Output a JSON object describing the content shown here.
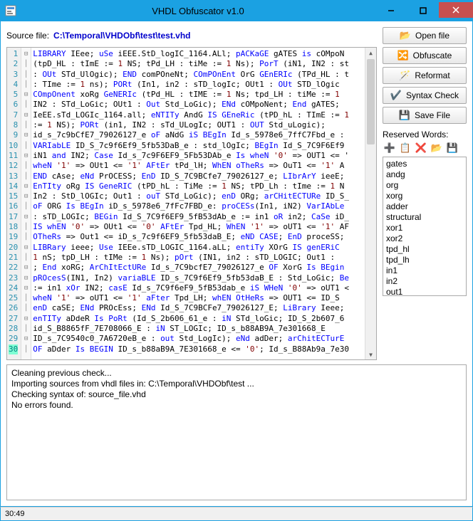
{
  "title": "VHDL Obfuscator v1.0",
  "source_label": "Source file:",
  "source_path": "C:\\Temporal\\VHDObf\\test\\test.vhd",
  "buttons": {
    "open": "Open file",
    "obfuscate": "Obfuscate",
    "reformat": "Reformat",
    "syntax": "Syntax Check",
    "save": "Save File"
  },
  "reserved_label": "Reserved Words:",
  "reserved_words": [
    "gates",
    "andg",
    "org",
    "xorg",
    "adder",
    "structural",
    "xor1",
    "xor2",
    "tpd_hl",
    "tpd_lh",
    "in1",
    "in2",
    "out1"
  ],
  "output_lines": [
    "Cleaning previous check...",
    "Importing sources from vhdl files in: C:\\Temporal\\VHDObf\\test ...",
    "Checking syntax of: source_file.vhd",
    "No errors found."
  ],
  "status": "30:49",
  "code_lines": [
    {
      "n": 1,
      "f": "⊟",
      "seg": [
        [
          "kw",
          "LIBRARY"
        ],
        [
          "txt",
          " IEee; "
        ],
        [
          "kw",
          "uSe"
        ],
        [
          "txt",
          " iEEE.StD_logIC_1164.ALl; "
        ],
        [
          "kw",
          "pACKaGE"
        ],
        [
          "txt",
          " gATES "
        ],
        [
          "kw",
          "is"
        ],
        [
          "txt",
          " cOMpoN"
        ]
      ]
    },
    {
      "n": 2,
      "f": "│",
      "seg": [
        [
          "txt",
          "(tpD_HL : tImE := "
        ],
        [
          "str",
          "1"
        ],
        [
          "txt",
          " NS; tPd_LH : tiMe := "
        ],
        [
          "str",
          "1"
        ],
        [
          "txt",
          " Ns); "
        ],
        [
          "kw",
          "PorT"
        ],
        [
          "txt",
          " (iN1, IN2 : st"
        ]
      ]
    },
    {
      "n": 3,
      "f": "│",
      "seg": [
        [
          "txt",
          ": "
        ],
        [
          "kw",
          "OUt"
        ],
        [
          "txt",
          " STd_UlOgic); "
        ],
        [
          "kw",
          "END"
        ],
        [
          "txt",
          " comPOneNt; "
        ],
        [
          "kw",
          "COmPOnEnt"
        ],
        [
          "txt",
          " OrG "
        ],
        [
          "kw",
          "GEnERIc"
        ],
        [
          "txt",
          " (TPd_HL : t"
        ]
      ]
    },
    {
      "n": 4,
      "f": "│",
      "seg": [
        [
          "txt",
          ": TIme := "
        ],
        [
          "str",
          "1"
        ],
        [
          "txt",
          " ns); "
        ],
        [
          "kw",
          "PORt"
        ],
        [
          "txt",
          " (In1, in2 : sTD_logIc; OUt1 : "
        ],
        [
          "kw",
          "OUt"
        ],
        [
          "txt",
          " STD_lOgic"
        ]
      ]
    },
    {
      "n": 5,
      "f": "⊟",
      "seg": [
        [
          "kw",
          "COmpOnent"
        ],
        [
          "txt",
          " xoRg "
        ],
        [
          "kw",
          "GeNERIc"
        ],
        [
          "txt",
          " (tPd_HL : tIME := "
        ],
        [
          "str",
          "1"
        ],
        [
          "txt",
          " Ns; tpd_LH : tiMe := "
        ],
        [
          "str",
          "1"
        ]
      ]
    },
    {
      "n": 6,
      "f": "│",
      "seg": [
        [
          "txt",
          "IN2 : STd_LoGic; OUt1 : "
        ],
        [
          "kw",
          "Out"
        ],
        [
          "txt",
          " Std_LoGic); "
        ],
        [
          "kw",
          "ENd"
        ],
        [
          "txt",
          " cOMpoNent; "
        ],
        [
          "kw",
          "End"
        ],
        [
          "txt",
          " gATES;"
        ]
      ]
    },
    {
      "n": 7,
      "f": "⊟",
      "seg": [
        [
          "txt",
          "IeEE.sTd_LOGIc_1164.all; "
        ],
        [
          "kw",
          "eNTITy"
        ],
        [
          "txt",
          " AndG "
        ],
        [
          "kw",
          "IS GEneRic"
        ],
        [
          "txt",
          " (tPD_hL : TImE := "
        ],
        [
          "str",
          "1"
        ]
      ]
    },
    {
      "n": 8,
      "f": "│",
      "seg": [
        [
          "txt",
          ":= "
        ],
        [
          "str",
          "1"
        ],
        [
          "txt",
          " NS); "
        ],
        [
          "kw",
          "PORt"
        ],
        [
          "txt",
          " (in1, IN2 : sTd_ULogIc; OUT1 : "
        ],
        [
          "kw",
          "OUT"
        ],
        [
          "txt",
          " Std_uLogic);"
        ]
      ]
    },
    {
      "n": 9,
      "f": "⊟",
      "seg": [
        [
          "txt",
          "id_s_7c9bCfE7_79026127_e "
        ],
        [
          "kw",
          "oF"
        ],
        [
          "txt",
          " aNdG "
        ],
        [
          "kw",
          "iS BEgIn"
        ],
        [
          "txt",
          " Id_s_5978e6_7ffC7Fbd_e :"
        ]
      ]
    },
    {
      "n": 10,
      "f": "│",
      "seg": [
        [
          "kw",
          "VARIabLE"
        ],
        [
          "txt",
          " ID_S_7c9f6Ef9_5fb53DaB_e : std_lOgIc; "
        ],
        [
          "kw",
          "BEgIn"
        ],
        [
          "txt",
          " Id_S_7C9F6Ef9"
        ]
      ]
    },
    {
      "n": 11,
      "f": "⊟",
      "seg": [
        [
          "txt",
          "iN1 "
        ],
        [
          "kw",
          "and"
        ],
        [
          "txt",
          " IN2; "
        ],
        [
          "kw",
          "Case"
        ],
        [
          "txt",
          " Id_s_7c9F6EF9_5Fb53DAb_e "
        ],
        [
          "kw",
          "Is wheN"
        ],
        [
          "txt",
          " "
        ],
        [
          "str",
          "'0'"
        ],
        [
          "txt",
          " => OUT1 <= '"
        ]
      ]
    },
    {
      "n": 12,
      "f": "│",
      "seg": [
        [
          "kw",
          "wheN"
        ],
        [
          "txt",
          " "
        ],
        [
          "str",
          "'1'"
        ],
        [
          "txt",
          " => OUt1 <= "
        ],
        [
          "str",
          "'1'"
        ],
        [
          "txt",
          " "
        ],
        [
          "kw",
          "AFtEr"
        ],
        [
          "txt",
          " tPd_lH; "
        ],
        [
          "kw",
          "WhEN oTheRs"
        ],
        [
          "txt",
          " => OuT1 <= "
        ],
        [
          "str",
          "'1'"
        ],
        [
          "txt",
          " A"
        ]
      ]
    },
    {
      "n": 13,
      "f": "│",
      "seg": [
        [
          "kw",
          "END"
        ],
        [
          "txt",
          " cAse; "
        ],
        [
          "kw",
          "eNd"
        ],
        [
          "txt",
          " PrOCESS; "
        ],
        [
          "kw",
          "EnD"
        ],
        [
          "txt",
          " ID_S_7C9BCfe7_79026127_e; "
        ],
        [
          "kw",
          "LIbrArY"
        ],
        [
          "txt",
          " ieeE;"
        ]
      ]
    },
    {
      "n": 14,
      "f": "⊟",
      "seg": [
        [
          "kw",
          "EnTIty"
        ],
        [
          "txt",
          " oRg "
        ],
        [
          "kw",
          "IS GeneRIC"
        ],
        [
          "txt",
          " (tPD_hL : TiMe := "
        ],
        [
          "str",
          "1"
        ],
        [
          "txt",
          " NS; tPD_Lh : tIme := "
        ],
        [
          "str",
          "1"
        ],
        [
          "txt",
          " N"
        ]
      ]
    },
    {
      "n": 15,
      "f": "⊟",
      "seg": [
        [
          "txt",
          "In2 : StD_lOGIc; Out1 : "
        ],
        [
          "kw",
          "ouT"
        ],
        [
          "txt",
          " STd_LoGic); "
        ],
        [
          "kw",
          "enD"
        ],
        [
          "txt",
          " ORg; "
        ],
        [
          "kw",
          "arCHitECTURe"
        ],
        [
          "txt",
          " ID_S_"
        ]
      ]
    },
    {
      "n": 16,
      "f": "│",
      "seg": [
        [
          "kw",
          "oF"
        ],
        [
          "txt",
          " ORG "
        ],
        [
          "kw",
          "Is BEgIn"
        ],
        [
          "txt",
          " iD_s_5978e6_7fFc7FBD_e: "
        ],
        [
          "kw",
          "proCESs"
        ],
        [
          "txt",
          "(In1, iN2) "
        ],
        [
          "kw",
          "VarIAbLe"
        ]
      ]
    },
    {
      "n": 17,
      "f": "⊟",
      "seg": [
        [
          "txt",
          ": sTD_LOGIc; "
        ],
        [
          "kw",
          "BEGin"
        ],
        [
          "txt",
          " Id_S_7C9f6EF9_5fB53dAb_e := in1 "
        ],
        [
          "kw",
          "oR"
        ],
        [
          "txt",
          " in2; "
        ],
        [
          "kw",
          "CaSe"
        ],
        [
          "txt",
          " iD_"
        ]
      ]
    },
    {
      "n": 18,
      "f": "│",
      "seg": [
        [
          "kw",
          "IS whEN"
        ],
        [
          "txt",
          " "
        ],
        [
          "str",
          "'0'"
        ],
        [
          "txt",
          " => OUt1 <= "
        ],
        [
          "str",
          "'0'"
        ],
        [
          "txt",
          " "
        ],
        [
          "kw",
          "AFtEr"
        ],
        [
          "txt",
          " Tpd_HL; "
        ],
        [
          "kw",
          "WhEN"
        ],
        [
          "txt",
          " "
        ],
        [
          "str",
          "'1'"
        ],
        [
          "txt",
          " => oUT1 <= "
        ],
        [
          "str",
          "'1'"
        ],
        [
          "txt",
          " AF"
        ]
      ]
    },
    {
      "n": 19,
      "f": "│",
      "seg": [
        [
          "kw",
          "OTheRs"
        ],
        [
          "txt",
          " => Out1 <= iD_s_7c9f6EF9_5fb53daB_E; "
        ],
        [
          "kw",
          "eND CASE"
        ],
        [
          "txt",
          "; "
        ],
        [
          "kw",
          "EnD"
        ],
        [
          "txt",
          " proceSS;"
        ]
      ]
    },
    {
      "n": 20,
      "f": "⊟",
      "seg": [
        [
          "kw",
          "LIBRary"
        ],
        [
          "txt",
          " ieee; "
        ],
        [
          "kw",
          "Use"
        ],
        [
          "txt",
          " IEEe.sTD_LOGIC_1164.aLL; "
        ],
        [
          "kw",
          "entiTy"
        ],
        [
          "txt",
          " XOrG "
        ],
        [
          "kw",
          "IS genERiC"
        ]
      ]
    },
    {
      "n": 21,
      "f": "│",
      "seg": [
        [
          "str",
          "1"
        ],
        [
          "txt",
          " nS; tpD_LH : tIMe := "
        ],
        [
          "str",
          "1"
        ],
        [
          "txt",
          " Ns); "
        ],
        [
          "kw",
          "pOrt"
        ],
        [
          "txt",
          " (IN1, in2 : sTD_LOGIC; Out1 :"
        ]
      ]
    },
    {
      "n": 22,
      "f": "⊟",
      "seg": [
        [
          "txt",
          "; "
        ],
        [
          "kw",
          "End"
        ],
        [
          "txt",
          " xoRG; "
        ],
        [
          "kw",
          "ArChItEctURe"
        ],
        [
          "txt",
          " Id_s_7C9bcfE7_79026127_e "
        ],
        [
          "kw",
          "OF"
        ],
        [
          "txt",
          " XorG "
        ],
        [
          "kw",
          "Is BEgin"
        ]
      ]
    },
    {
      "n": 23,
      "f": "⊟",
      "seg": [
        [
          "kw",
          "pROcesS"
        ],
        [
          "txt",
          "(IN1, In2) "
        ],
        [
          "kw",
          "variaBLE"
        ],
        [
          "txt",
          " ID_s_7C9f6Ef9_5fb53daB_E : Std_LoGic; "
        ],
        [
          "kw",
          "Be"
        ]
      ]
    },
    {
      "n": 24,
      "f": "⊟",
      "seg": [
        [
          "txt",
          ":= in1 "
        ],
        [
          "kw",
          "xOr"
        ],
        [
          "txt",
          " IN2; "
        ],
        [
          "kw",
          "casE"
        ],
        [
          "txt",
          " Id_s_7C9f6eF9_5fB53dab_e "
        ],
        [
          "kw",
          "iS WHeN"
        ],
        [
          "txt",
          " "
        ],
        [
          "str",
          "'0'"
        ],
        [
          "txt",
          " => oUT1 <"
        ]
      ]
    },
    {
      "n": 25,
      "f": "│",
      "seg": [
        [
          "kw",
          "wheN"
        ],
        [
          "txt",
          " "
        ],
        [
          "str",
          "'1'"
        ],
        [
          "txt",
          " => oUT1 <= "
        ],
        [
          "str",
          "'1'"
        ],
        [
          "txt",
          " "
        ],
        [
          "kw",
          "aFter"
        ],
        [
          "txt",
          " Tpd_LH; "
        ],
        [
          "kw",
          "whEN OtHeRs"
        ],
        [
          "txt",
          " => OUT1 <= ID_S"
        ]
      ]
    },
    {
      "n": 26,
      "f": "│",
      "seg": [
        [
          "kw",
          "enD"
        ],
        [
          "txt",
          " caSE; "
        ],
        [
          "kw",
          "ENd"
        ],
        [
          "txt",
          " PROcEss; "
        ],
        [
          "kw",
          "ENd"
        ],
        [
          "txt",
          " Id_S_7C9BCFe7_79026127_E; "
        ],
        [
          "kw",
          "LiBrary"
        ],
        [
          "txt",
          " Ieee;"
        ]
      ]
    },
    {
      "n": 27,
      "f": "⊟",
      "seg": [
        [
          "kw",
          "enTITy"
        ],
        [
          "txt",
          " aDdeR "
        ],
        [
          "kw",
          "Is PoRt"
        ],
        [
          "txt",
          " (Id_S_2b606_61_e : "
        ],
        [
          "kw",
          "iN"
        ],
        [
          "txt",
          " STd_loGic; ID_S_2b607_6"
        ]
      ]
    },
    {
      "n": 28,
      "f": "│",
      "seg": [
        [
          "txt",
          "id_S_B8865fF_7E708066_E : "
        ],
        [
          "kw",
          "iN"
        ],
        [
          "txt",
          " ST_LOGIc; ID_s_b88AB9A_7e301668_E"
        ]
      ]
    },
    {
      "n": 29,
      "f": "⊟",
      "seg": [
        [
          "txt",
          "ID_s_7C9540c0_7A6720eB_e : "
        ],
        [
          "kw",
          "out"
        ],
        [
          "txt",
          " Std_LogIc); "
        ],
        [
          "kw",
          "eNd"
        ],
        [
          "txt",
          " adDer; "
        ],
        [
          "kw",
          "arChitECTurE"
        ]
      ]
    },
    {
      "n": 30,
      "f": "│",
      "seg": [
        [
          "kw",
          "OF"
        ],
        [
          "txt",
          " aDder "
        ],
        [
          "kw",
          "Is BEGIN"
        ],
        [
          "txt",
          " ID_s_b88aB9A_7E301668_e <= "
        ],
        [
          "str",
          "'0'"
        ],
        [
          "txt",
          "; Id_s_B88Ab9a_7e30"
        ]
      ]
    }
  ]
}
